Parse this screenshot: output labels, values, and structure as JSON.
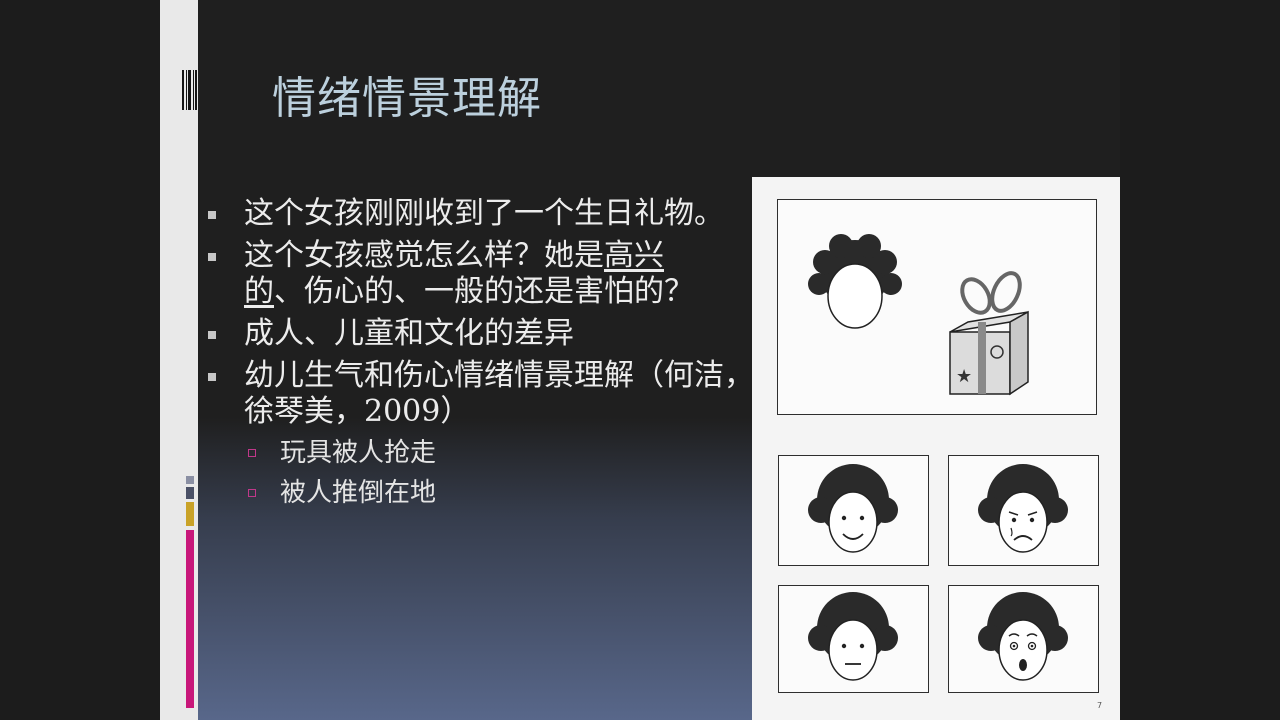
{
  "slide": {
    "title": "情绪情景理解",
    "bullets": [
      {
        "text": "这个女孩刚刚收到了一个生日礼物。"
      },
      {
        "pre": "这个女孩感觉怎么样？她是",
        "u1": "高兴",
        "u2": "的",
        "post": "、伤心的、一般的还是害怕的？"
      },
      {
        "text": "成人、儿童和文化的差异"
      },
      {
        "text": "幼儿生气和伤心情绪情景理解（何洁，徐琴美，2009）"
      }
    ],
    "sub_bullets": [
      "玩具被人抢走",
      "被人推倒在地"
    ],
    "page_number": "7"
  },
  "picture": {
    "top_panel": [
      "faceless-girl",
      "gift-box"
    ],
    "face_options": [
      "happy-face",
      "sad-face",
      "neutral-face",
      "scared-face"
    ]
  },
  "colors": {
    "background": "#1f1f1f",
    "title": "#bcd0dd",
    "text": "#ececec",
    "accent_pink": "#c8177a",
    "accent_gold": "#c9a227",
    "side_strip": "#e9e9e9"
  }
}
